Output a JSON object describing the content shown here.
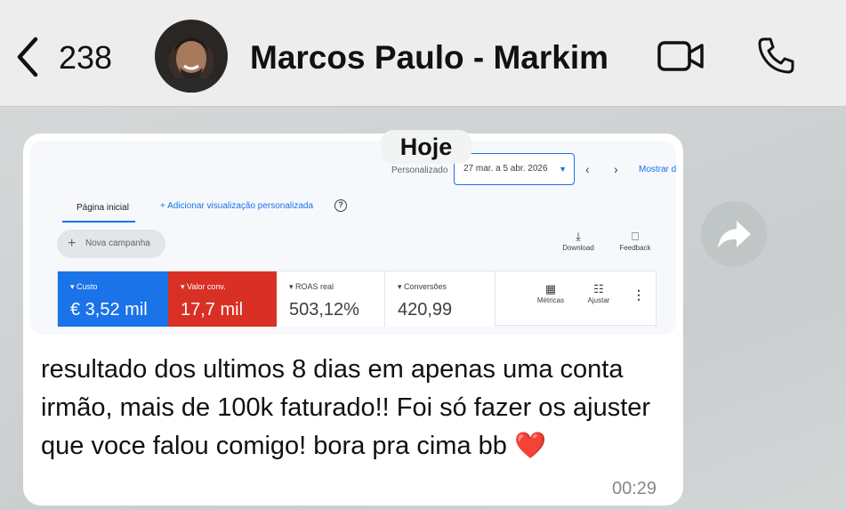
{
  "header": {
    "back_count": "238",
    "contact_name": "Marcos Paulo - Markim",
    "icons": {
      "back": "chevron-left-icon",
      "video": "video-camera-icon",
      "call": "phone-icon"
    }
  },
  "date_chip": "Hoje",
  "message": {
    "text": "resultado dos ultimos 8 dias em apenas uma conta irmão, mais de 100k faturado!! Foi só fazer os ajuster que voce falou comigo! bora pra cima bb",
    "emoji": "❤️",
    "time": "00:29",
    "screenshot": {
      "period_label": "Personalizado",
      "date_range": "27 mar. a 5 abr. 2026",
      "show_link": "Mostrar d",
      "tab_home": "Página inicial",
      "add_view": "+ Adicionar visualização personalizada",
      "new_campaign": "Nova campanha",
      "download": "Download",
      "feedback": "Feedback",
      "metrics": [
        {
          "label": "▾ Custo",
          "value": "€ 3,52 mil",
          "bg": "#1a73e8",
          "fg": "#ffffff"
        },
        {
          "label": "▾ Valor conv.",
          "value": "17,7 mil",
          "bg": "#d93025",
          "fg": "#ffffff"
        },
        {
          "label": "▾ ROAS real",
          "value": "503,12%",
          "bg": "#ffffff",
          "fg": "#3c4043"
        },
        {
          "label": "▾ Conversões",
          "value": "420,99",
          "bg": "#ffffff",
          "fg": "#3c4043"
        }
      ],
      "metricas_btn": "Métricas",
      "ajustar_btn": "Ajustar"
    }
  },
  "colors": {
    "header_bg": "#ecedec",
    "bubble_bg": "#ffffff",
    "google_blue": "#1a73e8",
    "google_red": "#d93025"
  }
}
